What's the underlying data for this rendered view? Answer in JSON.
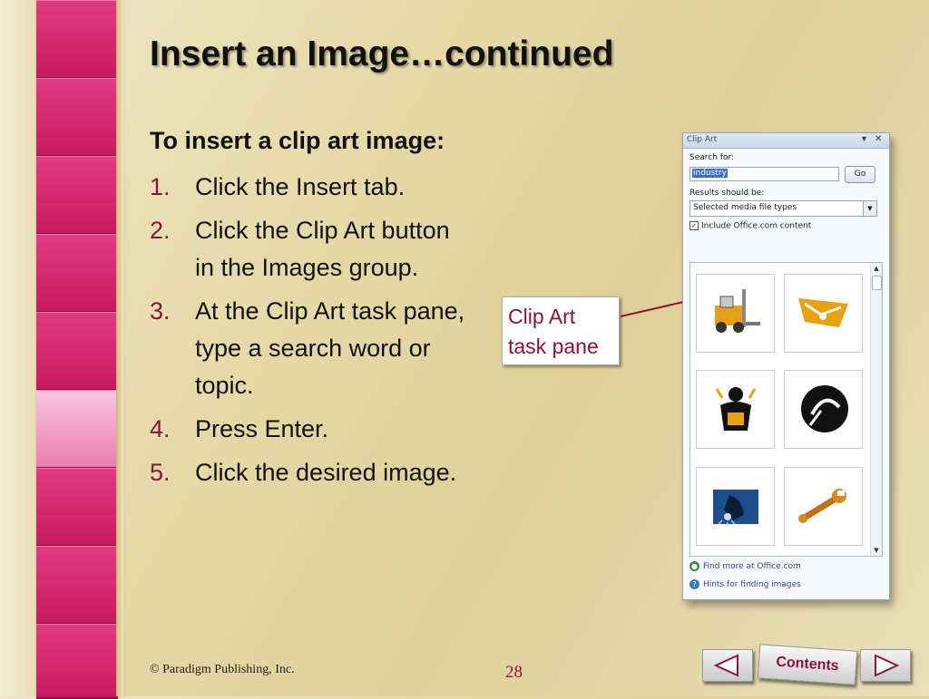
{
  "slide": {
    "title": "Insert an Image…continued",
    "heading": "To insert a clip art image:",
    "steps": [
      {
        "num": "1.",
        "text": "Click the Insert tab."
      },
      {
        "num": "2.",
        "text": "Click the Clip Art button in the Images group."
      },
      {
        "num": "3.",
        "text": "At the Clip Art task pane, type a search word or topic."
      },
      {
        "num": "4.",
        "text": "Press Enter."
      },
      {
        "num": "5.",
        "text": "Click the desired image."
      }
    ],
    "callout": {
      "line1": "Clip Art",
      "line2": "task pane"
    },
    "footer": "© Paradigm Publishing, Inc.",
    "page_number": "28",
    "nav": {
      "contents_label": "Contents"
    }
  },
  "clip_art_pane": {
    "title": "Clip Art",
    "search_label": "Search for:",
    "search_value": "industry",
    "go_label": "Go",
    "results_label": "Results should be:",
    "results_value": "Selected media file types",
    "include_label": "Include Office.com content",
    "include_checked": true,
    "results": [
      {
        "icon": "forklift-icon"
      },
      {
        "icon": "conveyor-icon"
      },
      {
        "icon": "worker-icon"
      },
      {
        "icon": "hardhat-tools-icon"
      },
      {
        "icon": "welder-icon"
      },
      {
        "icon": "wrench-icon"
      }
    ],
    "find_more_label": "Find more at Office.com",
    "hints_label": "Hints for finding images"
  },
  "colors": {
    "accent": "#8a1538",
    "strip_pink": "#d9246e",
    "clipart_orange": "#e9a10d"
  }
}
